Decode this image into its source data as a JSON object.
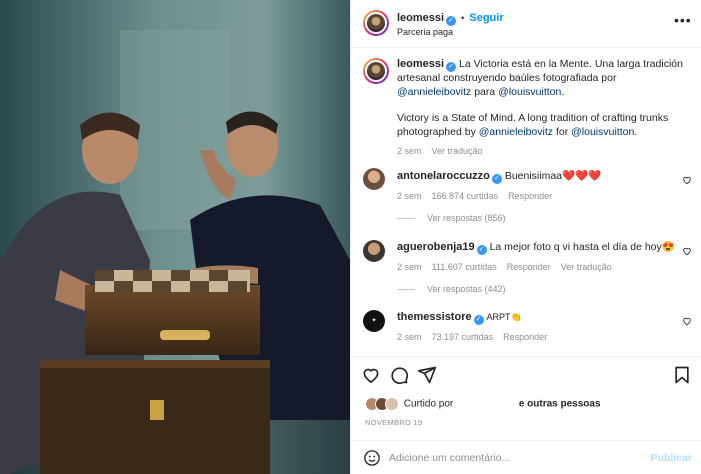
{
  "post": {
    "username": "leomessi",
    "follow_label": "Seguir",
    "dot": "•",
    "partnership": "Parceria paga",
    "caption_user": "leomessi",
    "caption_p1": "La Victoria está en la Mente. Una larga tradición artesanal construyendo baúles fotografiada por ",
    "caption_link1": "@annieleibovitz",
    "caption_p2": " para ",
    "caption_link2": "@louisvuitton",
    "caption_p3": ".",
    "caption_en_p1": "Victory is a State of Mind. A long tradition of crafting trunks photographed by ",
    "caption_en_link1": "@annieleibovitz",
    "caption_en_p2": " for ",
    "caption_en_link2": "@louisvuitton",
    "caption_en_p3": ".",
    "caption_time": "2 sem",
    "see_translation": "Ver tradução"
  },
  "comments": [
    {
      "user": "antonelaroccuzzo",
      "text": "Buenisiimaa❤️❤️❤️",
      "time": "2 sem",
      "likes": "166.874 curtidas",
      "reply": "Responder",
      "translate": "",
      "view_replies": "Ver respostas (856)"
    },
    {
      "user": "aguerobenja19",
      "text": "La mejor foto q vi hasta el día de hoy😍",
      "time": "2 sem",
      "likes": "111.607 curtidas",
      "reply": "Responder",
      "translate": "Ver tradução",
      "view_replies": "Ver respostas (442)"
    },
    {
      "user": "themessistore",
      "text": "ARPT👏",
      "time": "2 sem",
      "likes": "73.197 curtidas",
      "reply": "Responder",
      "translate": "",
      "view_replies": ""
    }
  ],
  "actions": {
    "liked_by": "Curtido por",
    "and_others": "e outras pessoas",
    "date": "NOVEMBRO 19"
  },
  "compose": {
    "placeholder": "Adicione um comentário...",
    "post_label": "Publicar"
  },
  "colors": {
    "link": "#00376b",
    "accent": "#0095f6",
    "heart": "#ed4956"
  }
}
